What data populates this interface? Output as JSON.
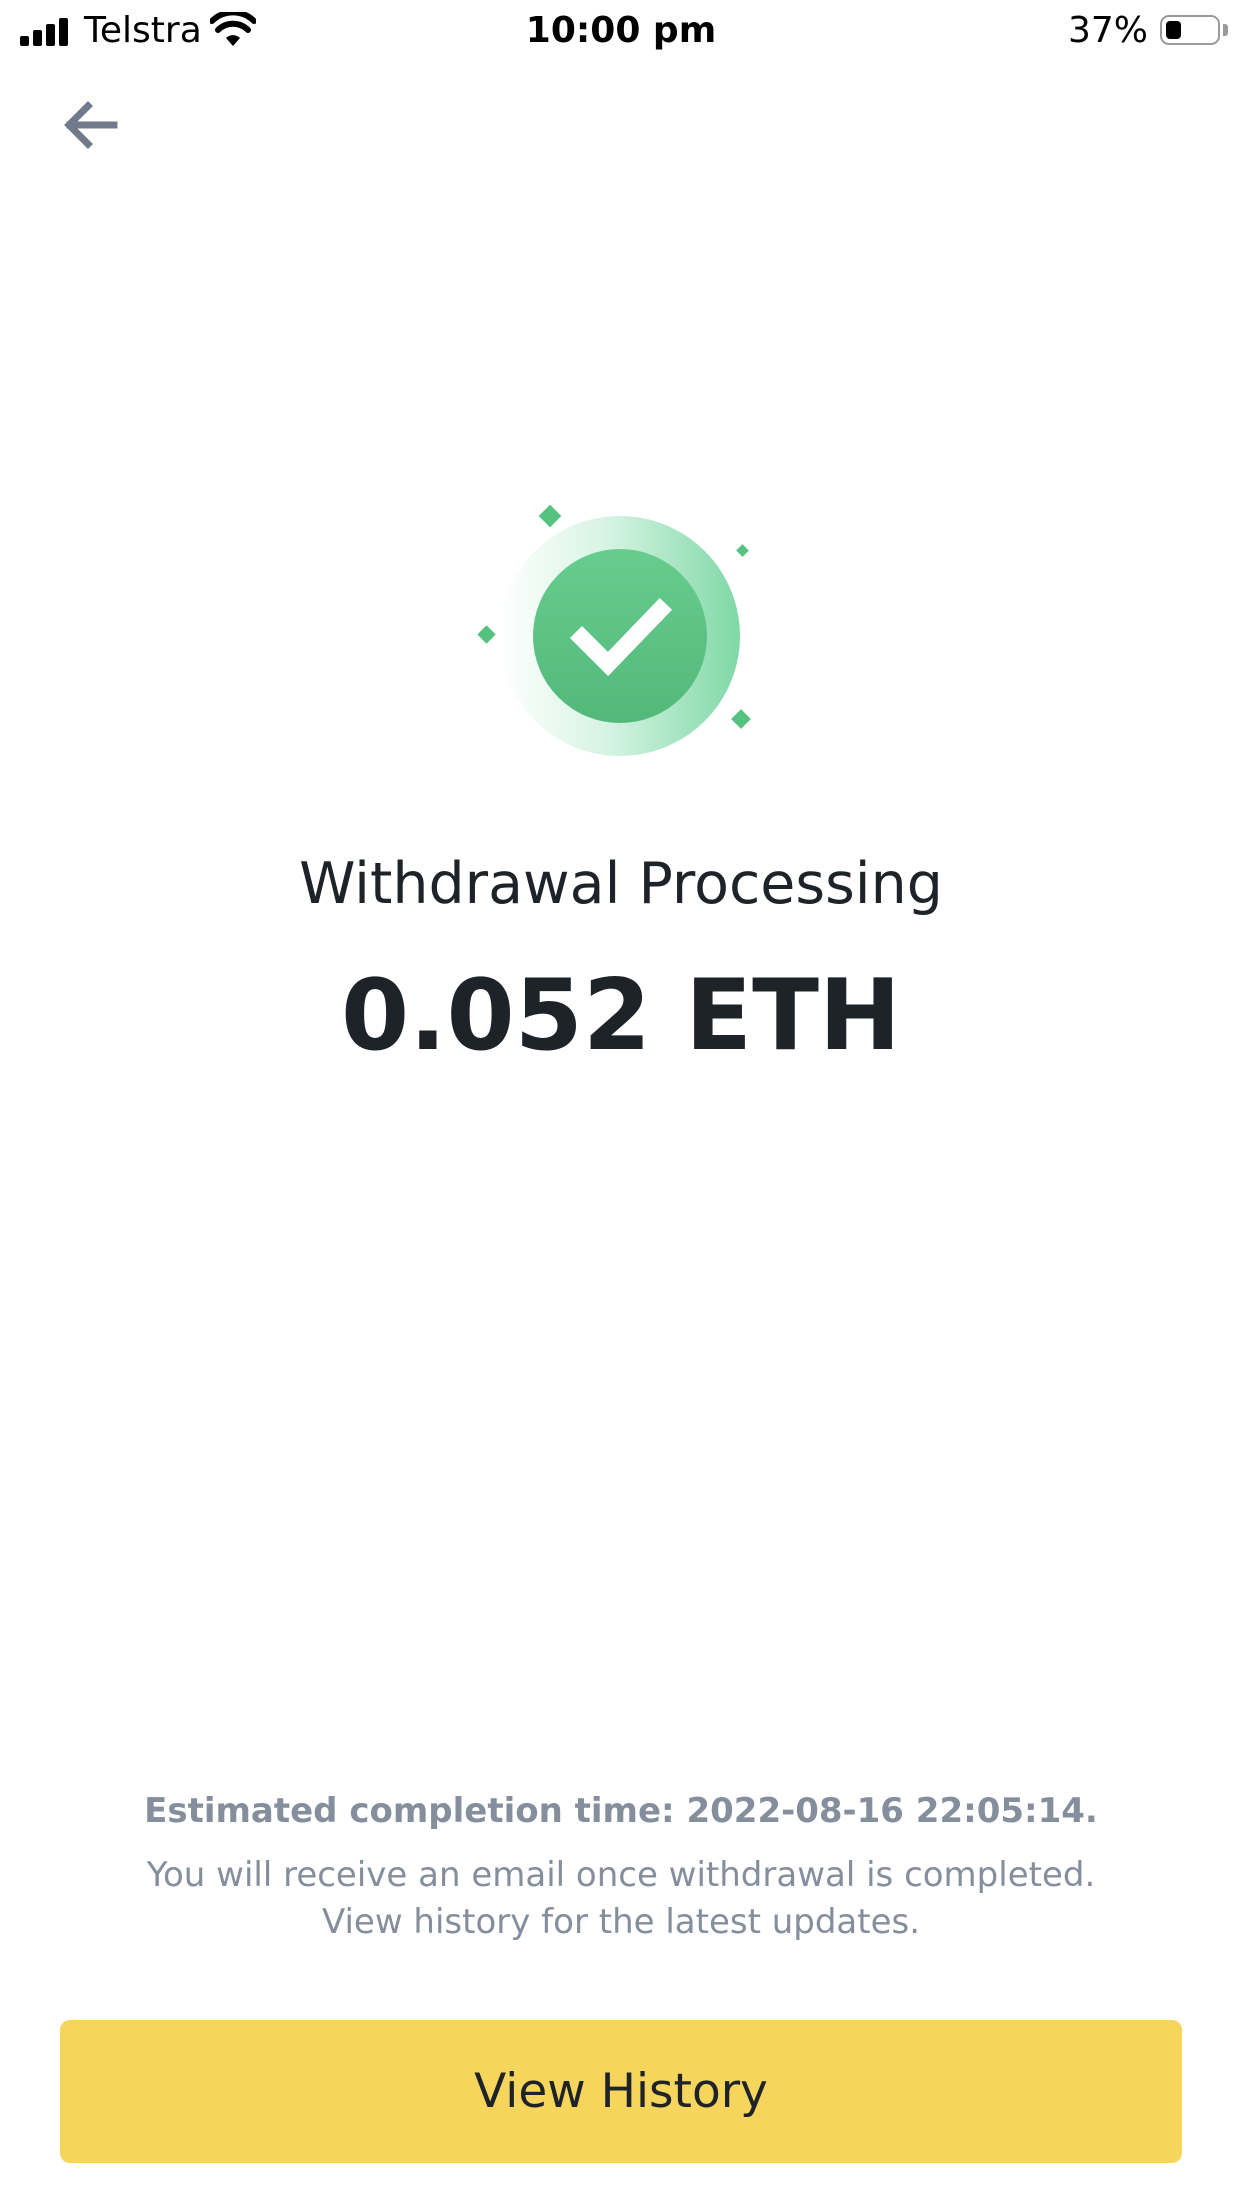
{
  "status_bar": {
    "carrier": "Telstra",
    "time": "10:00 pm",
    "battery_percent": "37%",
    "battery_level": 0.37,
    "signal_bars": 4
  },
  "nav": {
    "back_icon": "arrow-left-icon"
  },
  "illustration": {
    "icon": "check-circle-icon",
    "accent_color": "#5dc88a"
  },
  "main": {
    "title": "Withdrawal Processing",
    "amount": "0.052 ETH"
  },
  "info": {
    "estimated_completion": "Estimated completion time: 2022-08-16 22:05:14.",
    "note_line1": "You will receive an email once withdrawal is completed.",
    "note_line2": "View history for the latest updates."
  },
  "actions": {
    "view_history_label": "View History",
    "button_color": "#f6d55c"
  }
}
